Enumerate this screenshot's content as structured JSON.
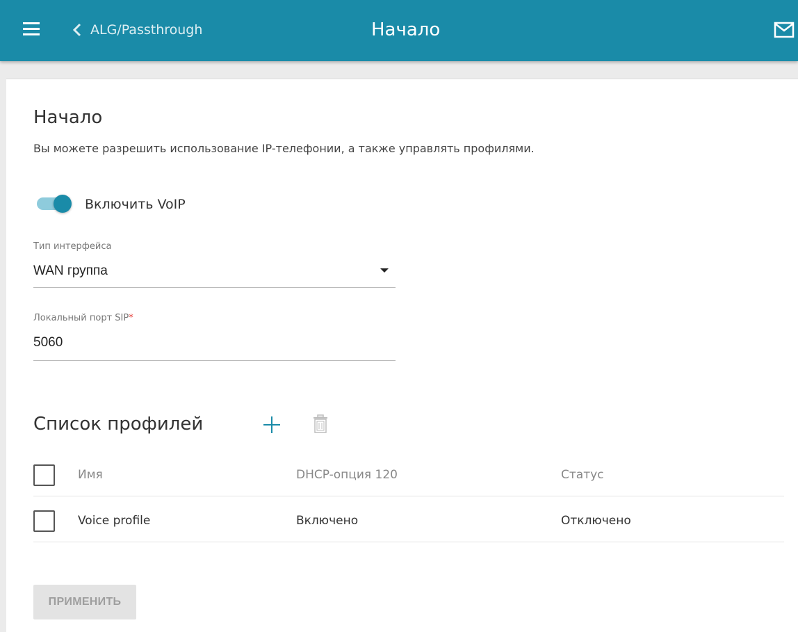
{
  "header": {
    "back_label": "ALG/Passthrough",
    "title": "Начало",
    "icons": [
      "menu-icon",
      "chevron-left-icon",
      "mail-icon"
    ],
    "bar_color": "#1a8ba8"
  },
  "page": {
    "title": "Начало",
    "description": "Вы можете разрешить использование IP-телефонии, а также управлять профилями."
  },
  "voip_toggle": {
    "label": "Включить VoIP",
    "enabled": true
  },
  "interface_type": {
    "label": "Тип интерфейса",
    "value": "WAN группа"
  },
  "sip_port": {
    "label": "Локальный порт SIP",
    "required_mark": "*",
    "value": "5060"
  },
  "profiles": {
    "title": "Список профилей",
    "icons": [
      "plus-icon",
      "trash-icon"
    ],
    "columns": [
      "Имя",
      "DHCP-опция 120",
      "Статус"
    ],
    "rows": [
      {
        "name": "Voice profile",
        "dhcp_option": "Включено",
        "status": "Отключено"
      }
    ]
  },
  "apply_button": {
    "label": "ПРИМЕНИТЬ"
  },
  "colors": {
    "accent": "#1a8ba8",
    "required": "#e53935"
  }
}
